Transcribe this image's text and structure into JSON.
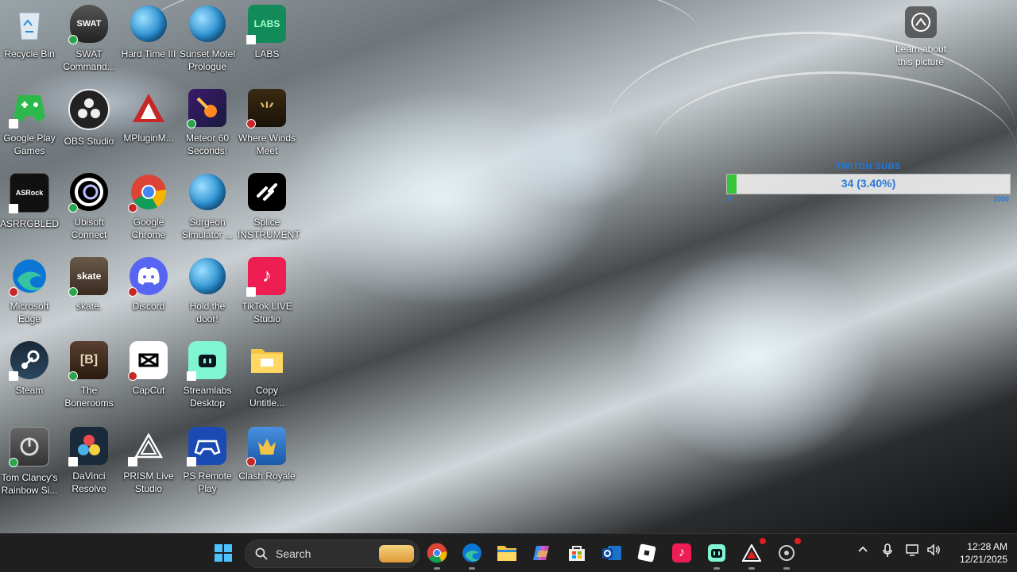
{
  "desktop": {
    "icons": [
      {
        "label": "Recycle Bin"
      },
      {
        "label": "SWAT\nCommand..."
      },
      {
        "label": "Hard Time III"
      },
      {
        "label": "Sunset Motel\nPrologue"
      },
      {
        "label": "LABS",
        "img_text": "LABS"
      },
      {
        "label": "Google Play\nGames"
      },
      {
        "label": "OBS Studio"
      },
      {
        "label": "MPluginM..."
      },
      {
        "label": "Meteor 60\nSeconds!"
      },
      {
        "label": "Where Winds\nMeet"
      },
      {
        "label": "ASRRGBLED"
      },
      {
        "label": "Ubisoft\nConnect"
      },
      {
        "label": "Google\nChrome"
      },
      {
        "label": "Surgeon\nSimulator ..."
      },
      {
        "label": "Splice\nINSTRUMENT"
      },
      {
        "label": "Microsoft\nEdge"
      },
      {
        "label": "skate.",
        "img_text": "skate"
      },
      {
        "label": "Discord"
      },
      {
        "label": "Hold the\ndoor!"
      },
      {
        "label": "TikTok LIVE\nStudio"
      },
      {
        "label": "Steam"
      },
      {
        "label": "The\nBonerooms",
        "img_text": "[B]"
      },
      {
        "label": "CapCut"
      },
      {
        "label": "Streamlabs\nDesktop"
      },
      {
        "label": "Copy\nUntitle..."
      },
      {
        "label": "Tom Clancy's\nRainbow Si..."
      },
      {
        "label": "DaVinci\nResolve"
      },
      {
        "label": "PRISM Live\nStudio"
      },
      {
        "label": "PS Remote\nPlay"
      },
      {
        "label": "Clash Royale"
      }
    ],
    "learn_label": "Learn about\nthis picture"
  },
  "subs_widget": {
    "title": "TWITCH SUBS",
    "bar_text": "34 (3.40%)",
    "progress": 0.034,
    "min": "0",
    "max": "1000",
    "fill_color": "#35c535"
  },
  "taskbar": {
    "search_placeholder": "Search",
    "time": "12:28 AM",
    "date": "12/21/2025",
    "pinned": [
      "windows-start-icon",
      "chrome-icon",
      "edge-icon",
      "file-explorer-icon",
      "copilot-icon",
      "microsoft-store-icon",
      "outlook-icon",
      "roblox-icon",
      "tiktok-icon",
      "streamlabs-icon",
      "prism-icon",
      "settings-icon"
    ]
  }
}
